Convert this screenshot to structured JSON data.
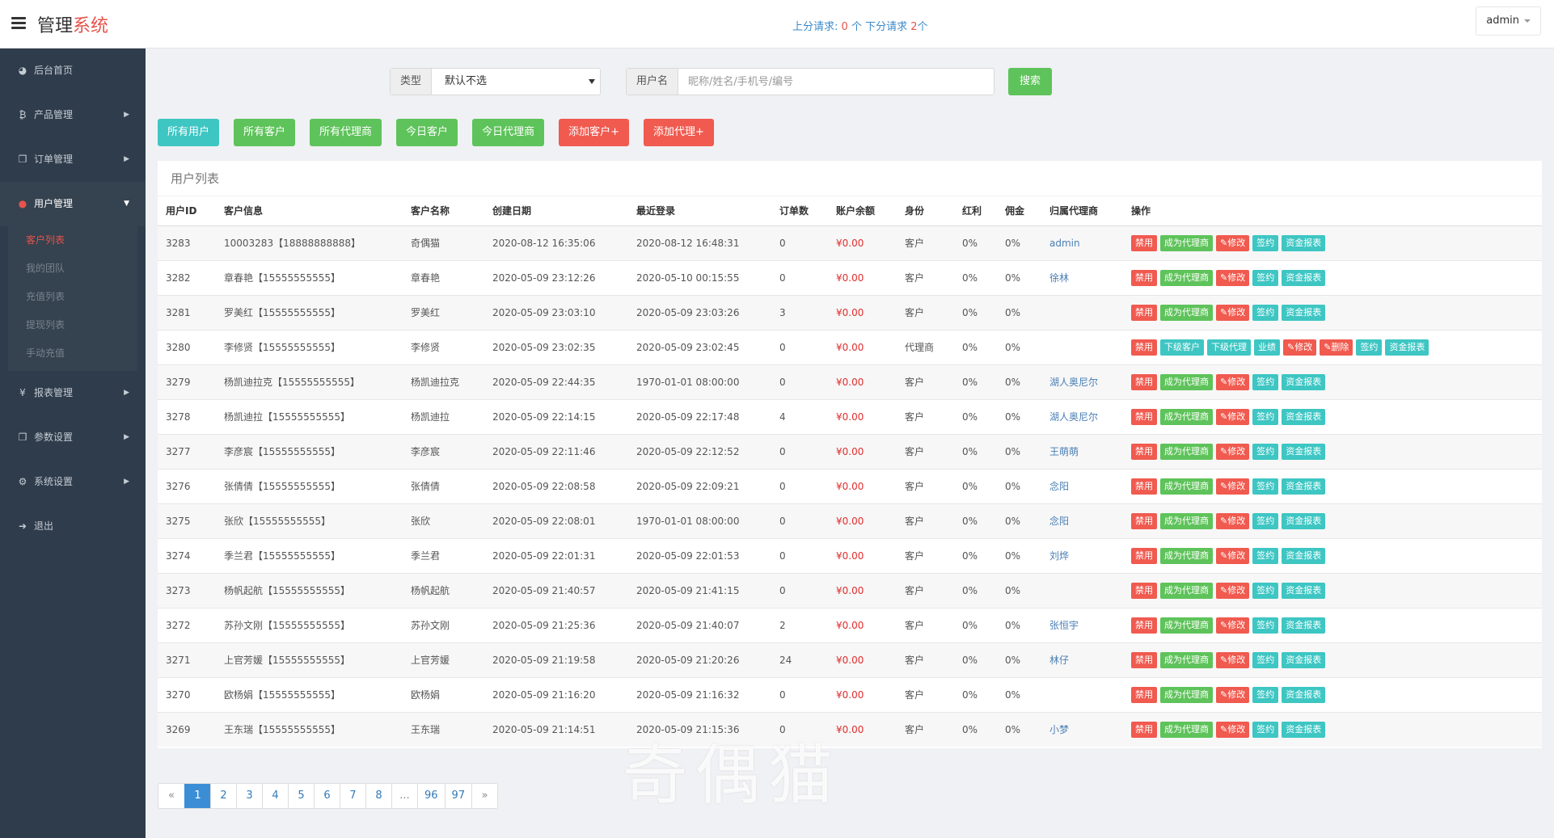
{
  "header": {
    "brand_main": "管理",
    "brand_accent": "系统",
    "requests": {
      "up_label": "上分请求:",
      "up_count": "0",
      "up_unit": "个",
      "down_label": "下分请求",
      "down_count": "2",
      "down_unit": "个"
    },
    "user": "admin"
  },
  "sidebar": {
    "items": [
      {
        "label": "后台首页",
        "icon": "dashboard-icon",
        "glyph": "◕",
        "arrow": ""
      },
      {
        "label": "产品管理",
        "icon": "bitcoin-icon",
        "glyph": "₿",
        "arrow": "▶"
      },
      {
        "label": "订单管理",
        "icon": "copy-icon",
        "glyph": "❐",
        "arrow": "▶"
      },
      {
        "label": "用户管理",
        "icon": "user-icon",
        "glyph": "●",
        "arrow": "▼"
      },
      {
        "label": "报表管理",
        "icon": "yen-icon",
        "glyph": "¥",
        "arrow": "▶"
      },
      {
        "label": "参数设置",
        "icon": "copy-icon",
        "glyph": "❐",
        "arrow": "▶"
      },
      {
        "label": "系统设置",
        "icon": "gears-icon",
        "glyph": "⚙",
        "arrow": "▶"
      },
      {
        "label": "退出",
        "icon": "sign-out-icon",
        "glyph": "➜",
        "arrow": ""
      }
    ],
    "sub_items": [
      "客户列表",
      "我的团队",
      "充值列表",
      "提现列表",
      "手动充值"
    ]
  },
  "search": {
    "type_label": "类型",
    "type_value": "默认不选",
    "username_label": "用户名",
    "username_placeholder": "昵称/姓名/手机号/编号",
    "button": "搜索"
  },
  "filters": [
    {
      "label": "所有用户",
      "color": "cyan"
    },
    {
      "label": "所有客户",
      "color": "green"
    },
    {
      "label": "所有代理商",
      "color": "green"
    },
    {
      "label": "今日客户",
      "color": "green"
    },
    {
      "label": "今日代理商",
      "color": "green"
    },
    {
      "label": "添加客户+",
      "color": "red"
    },
    {
      "label": "添加代理+",
      "color": "red"
    }
  ],
  "panel_title": "用户列表",
  "columns": [
    "用户ID",
    "客户信息",
    "客户名称",
    "创建日期",
    "最近登录",
    "订单数",
    "账户余额",
    "身份",
    "红利",
    "佣金",
    "归属代理商",
    "操作"
  ],
  "customer_ops": [
    "禁用",
    "成为代理商",
    "✎修改",
    "签约",
    "资金报表"
  ],
  "agent_ops": [
    "禁用",
    "下级客户",
    "下级代理",
    "业绩",
    "✎修改",
    "✎删除",
    "签约",
    "资金报表"
  ],
  "rows": [
    {
      "id": "3283",
      "info": "10003283【18888888888】",
      "name": "奇偶猫",
      "created": "2020-08-12 16:35:06",
      "login": "2020-08-12 16:48:31",
      "orders": "0",
      "balance": "¥0.00",
      "role": "客户",
      "bonus": "0%",
      "commission": "0%",
      "agent": "admin",
      "type": "customer"
    },
    {
      "id": "3282",
      "info": "章春艳【15555555555】",
      "name": "章春艳",
      "created": "2020-05-09 23:12:26",
      "login": "2020-05-10 00:15:55",
      "orders": "0",
      "balance": "¥0.00",
      "role": "客户",
      "bonus": "0%",
      "commission": "0%",
      "agent": "徐林",
      "type": "customer"
    },
    {
      "id": "3281",
      "info": "罗美红【15555555555】",
      "name": "罗美红",
      "created": "2020-05-09 23:03:10",
      "login": "2020-05-09 23:03:26",
      "orders": "3",
      "balance": "¥0.00",
      "role": "客户",
      "bonus": "0%",
      "commission": "0%",
      "agent": "",
      "type": "customer"
    },
    {
      "id": "3280",
      "info": "李修贤【15555555555】",
      "name": "李修贤",
      "created": "2020-05-09 23:02:35",
      "login": "2020-05-09 23:02:45",
      "orders": "0",
      "balance": "¥0.00",
      "role": "代理商",
      "bonus": "0%",
      "commission": "0%",
      "agent": "",
      "type": "agent"
    },
    {
      "id": "3279",
      "info": "杨凯迪拉克【15555555555】",
      "name": "杨凯迪拉克",
      "created": "2020-05-09 22:44:35",
      "login": "1970-01-01 08:00:00",
      "orders": "0",
      "balance": "¥0.00",
      "role": "客户",
      "bonus": "0%",
      "commission": "0%",
      "agent": "湖人奥尼尔",
      "type": "customer"
    },
    {
      "id": "3278",
      "info": "杨凯迪拉【15555555555】",
      "name": "杨凯迪拉",
      "created": "2020-05-09 22:14:15",
      "login": "2020-05-09 22:17:48",
      "orders": "4",
      "balance": "¥0.00",
      "role": "客户",
      "bonus": "0%",
      "commission": "0%",
      "agent": "湖人奥尼尔",
      "type": "customer"
    },
    {
      "id": "3277",
      "info": "李彦宸【15555555555】",
      "name": "李彦宸",
      "created": "2020-05-09 22:11:46",
      "login": "2020-05-09 22:12:52",
      "orders": "0",
      "balance": "¥0.00",
      "role": "客户",
      "bonus": "0%",
      "commission": "0%",
      "agent": "王萌萌",
      "type": "customer"
    },
    {
      "id": "3276",
      "info": "张倩倩【15555555555】",
      "name": "张倩倩",
      "created": "2020-05-09 22:08:58",
      "login": "2020-05-09 22:09:21",
      "orders": "0",
      "balance": "¥0.00",
      "role": "客户",
      "bonus": "0%",
      "commission": "0%",
      "agent": "念阳",
      "type": "customer"
    },
    {
      "id": "3275",
      "info": "张欣【15555555555】",
      "name": "张欣",
      "created": "2020-05-09 22:08:01",
      "login": "1970-01-01 08:00:00",
      "orders": "0",
      "balance": "¥0.00",
      "role": "客户",
      "bonus": "0%",
      "commission": "0%",
      "agent": "念阳",
      "type": "customer"
    },
    {
      "id": "3274",
      "info": "季兰君【15555555555】",
      "name": "季兰君",
      "created": "2020-05-09 22:01:31",
      "login": "2020-05-09 22:01:53",
      "orders": "0",
      "balance": "¥0.00",
      "role": "客户",
      "bonus": "0%",
      "commission": "0%",
      "agent": "刘烨",
      "type": "customer"
    },
    {
      "id": "3273",
      "info": "杨帆起航【15555555555】",
      "name": "杨帆起航",
      "created": "2020-05-09 21:40:57",
      "login": "2020-05-09 21:41:15",
      "orders": "0",
      "balance": "¥0.00",
      "role": "客户",
      "bonus": "0%",
      "commission": "0%",
      "agent": "",
      "type": "customer"
    },
    {
      "id": "3272",
      "info": "苏孙文刚【15555555555】",
      "name": "苏孙文刚",
      "created": "2020-05-09 21:25:36",
      "login": "2020-05-09 21:40:07",
      "orders": "2",
      "balance": "¥0.00",
      "role": "客户",
      "bonus": "0%",
      "commission": "0%",
      "agent": "张恒宇",
      "type": "customer"
    },
    {
      "id": "3271",
      "info": "上官芳媛【15555555555】",
      "name": "上官芳媛",
      "created": "2020-05-09 21:19:58",
      "login": "2020-05-09 21:20:26",
      "orders": "24",
      "balance": "¥0.00",
      "role": "客户",
      "bonus": "0%",
      "commission": "0%",
      "agent": "林仔",
      "type": "customer"
    },
    {
      "id": "3270",
      "info": "欧杨娟【15555555555】",
      "name": "欧杨娟",
      "created": "2020-05-09 21:16:20",
      "login": "2020-05-09 21:16:32",
      "orders": "0",
      "balance": "¥0.00",
      "role": "客户",
      "bonus": "0%",
      "commission": "0%",
      "agent": "",
      "type": "customer"
    },
    {
      "id": "3269",
      "info": "王东瑞【15555555555】",
      "name": "王东瑞",
      "created": "2020-05-09 21:14:51",
      "login": "2020-05-09 21:15:36",
      "orders": "0",
      "balance": "¥0.00",
      "role": "客户",
      "bonus": "0%",
      "commission": "0%",
      "agent": "小梦",
      "type": "customer"
    }
  ],
  "pagination": [
    "«",
    "1",
    "2",
    "3",
    "4",
    "5",
    "6",
    "7",
    "8",
    "...",
    "96",
    "97",
    "»"
  ],
  "pagination_active": "1",
  "watermark": "奇偶猫"
}
